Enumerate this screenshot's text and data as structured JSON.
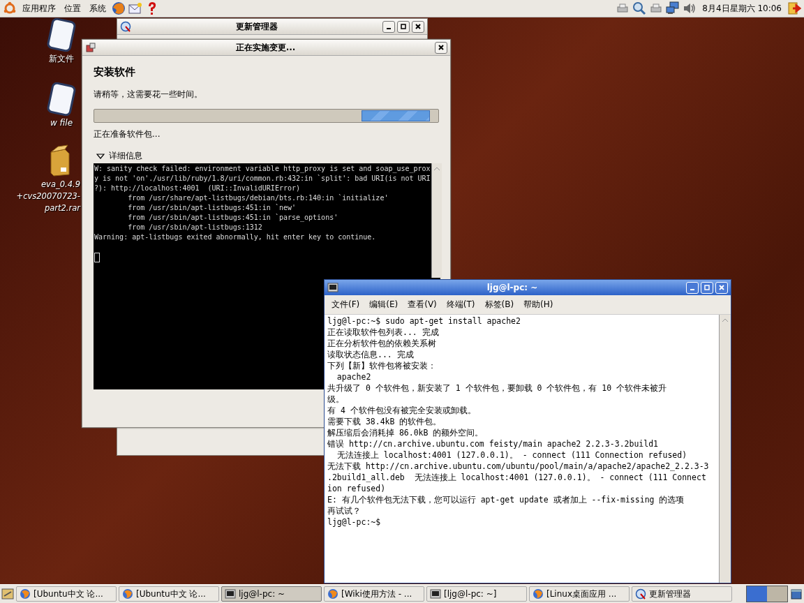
{
  "top_panel": {
    "menus": [
      "应用程序",
      "位置",
      "系统"
    ],
    "launchers": [
      {
        "kind": "browser"
      },
      {
        "kind": "mail"
      },
      {
        "kind": "help"
      }
    ],
    "clock": "8月4日星期六 10:06"
  },
  "desktop_icons": [
    {
      "kind": "document",
      "label_lines": [
        "新文件"
      ]
    },
    {
      "kind": "document",
      "label_lines": [
        "w file"
      ]
    },
    {
      "kind": "archive",
      "label_lines": [
        "eva_0.4.9",
        "+cvs20070723-",
        "part2.rar"
      ]
    }
  ],
  "update_manager": {
    "title": "更新管理器"
  },
  "dialog": {
    "title": "正在实施变更...",
    "heading": "安装软件",
    "message": "请稍等，这需要花一些时间。",
    "progress": {
      "indeterminate": true
    },
    "status": "正在准备软件包...",
    "details": {
      "label": "详细信息",
      "expanded": true,
      "lines": [
        "W: sanity check failed: environment variable http_proxy is set and soap_use_prox",
        "y is not 'on'./usr/lib/ruby/1.8/uri/common.rb:432:in `split': bad URI(is not URI",
        "?): http://localhost:4001  (URI::InvalidURIError)",
        "        from /usr/share/apt-listbugs/debian/bts.rb:140:in `initialize'",
        "        from /usr/sbin/apt-listbugs:451:in `new'",
        "        from /usr/sbin/apt-listbugs:451:in `parse_options'",
        "        from /usr/sbin/apt-listbugs:1312",
        "Warning: apt-listbugs exited abnormally, hit enter key to continue."
      ]
    }
  },
  "terminal": {
    "title": "ljg@l-pc: ~",
    "menus": [
      "文件(F)",
      "编辑(E)",
      "查看(V)",
      "终端(T)",
      "标签(B)",
      "帮助(H)"
    ],
    "lines": [
      "ljg@l-pc:~$ sudo apt-get install apache2",
      "正在读取软件包列表... 完成",
      "正在分析软件包的依赖关系树",
      "读取状态信息... 完成",
      "下列【新】软件包将被安装：",
      "  apache2",
      "共升级了 0 个软件包，新安装了 1 个软件包，要卸载 0 个软件包，有 10 个软件未被升",
      "级。",
      "有 4 个软件包没有被完全安装或卸载。",
      "需要下载 38.4kB 的软件包。",
      "解压缩后会消耗掉 86.0kB 的额外空间。",
      "错误 http://cn.archive.ubuntu.com feisty/main apache2 2.2.3-3.2build1",
      "  无法连接上 localhost:4001 (127.0.0.1)。 - connect (111 Connection refused)",
      "无法下载 http://cn.archive.ubuntu.com/ubuntu/pool/main/a/apache2/apache2_2.2.3-3",
      ".2build1_all.deb  无法连接上 localhost:4001 (127.0.0.1)。 - connect (111 Connect",
      "ion refused)",
      "E: 有几个软件包无法下载，您可以运行 apt-get update 或者加上 --fix-missing 的选项",
      "再试试？",
      "ljg@l-pc:~$"
    ]
  },
  "taskbar": {
    "items": [
      {
        "kind": "browser",
        "label": "[Ubuntu中文 论...",
        "selected": false
      },
      {
        "kind": "browser",
        "label": "[Ubuntu中文 论...",
        "selected": false
      },
      {
        "kind": "terminal",
        "label": "ljg@l-pc: ~",
        "selected": true
      },
      {
        "kind": "browser",
        "label": "[Wiki使用方法 - ...",
        "selected": false
      },
      {
        "kind": "terminal",
        "label": "[ljg@l-pc: ~]",
        "selected": false
      },
      {
        "kind": "browser",
        "label": "[Linux桌面应用 ...",
        "selected": false
      },
      {
        "kind": "update",
        "label": "更新管理器",
        "selected": false
      }
    ]
  }
}
